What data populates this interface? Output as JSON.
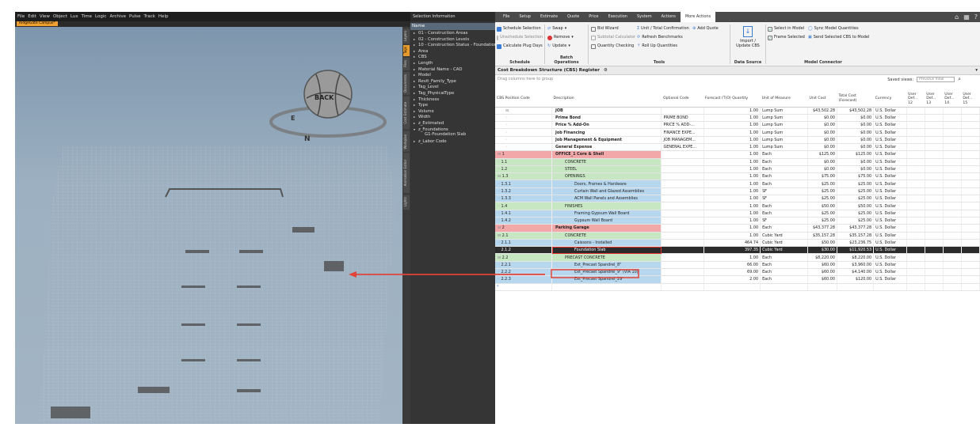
{
  "viewer": {
    "menu": [
      "File",
      "Edit",
      "View",
      "Object",
      "Lux",
      "Time",
      "Logic",
      "Archive",
      "Pulse",
      "Track",
      "Help"
    ],
    "doc_tab": "RidgeGate Campus*",
    "side_tabs": [
      "Layers",
      "Tags",
      "Files",
      "Documents",
      "Cost Estimate",
      "Workplan",
      "Animation Editor",
      "Lights"
    ],
    "active_side_tab": "Tags",
    "gizmo_label": "BACK",
    "compass": [
      "E",
      "N"
    ],
    "panel_title": "Selection Information",
    "name_header": "Name",
    "tree": [
      {
        "label": "01 - Construction Areas",
        "expanded": false
      },
      {
        "label": "02 - Construction Levels",
        "expanded": false
      },
      {
        "label": "10 - Construction Status - Foundation",
        "expanded": false
      },
      {
        "label": "Area",
        "expanded": false
      },
      {
        "label": "CBS",
        "expanded": false
      },
      {
        "label": "Length",
        "expanded": false
      },
      {
        "label": "Material Name - CAD",
        "expanded": false
      },
      {
        "label": "Model",
        "expanded": false
      },
      {
        "label": "Revit_Family_Type",
        "expanded": false
      },
      {
        "label": "Tag_Level",
        "expanded": false
      },
      {
        "label": "Tag_PhysicalType",
        "expanded": false
      },
      {
        "label": "Thickness",
        "expanded": false
      },
      {
        "label": "Type",
        "expanded": false
      },
      {
        "label": "Volume",
        "expanded": false
      },
      {
        "label": "Width",
        "expanded": false
      },
      {
        "label": "z_Estimated",
        "expanded": false
      },
      {
        "label": "z_Foundations",
        "expanded": true
      },
      {
        "label": "G1-Foundation Slab",
        "child": true
      },
      {
        "label": "z_Labor Code",
        "expanded": false
      }
    ]
  },
  "ribbon": {
    "tabs": [
      "File",
      "Setup",
      "Estimate",
      "Quote",
      "Price",
      "Execution",
      "System",
      "Actions",
      "More Actions"
    ],
    "active_tab": "More Actions",
    "schedule": {
      "items": [
        "Schedule Selection",
        "Unschedule Selection",
        "Calculate Plug Days"
      ],
      "label": "Schedule"
    },
    "batch": {
      "items": [
        "Swap",
        "Remove",
        "Update"
      ],
      "label": "Batch Operations"
    },
    "tools": {
      "col1": [
        "Bid Wizard",
        "Subtotal Calculator",
        "Quantity Checking"
      ],
      "col2": [
        "Unit / Total Confirmation",
        "Refresh Benchmarks",
        "Roll Up Quantities"
      ],
      "col3": [
        "Add Quote"
      ],
      "label": "Tools"
    },
    "datasource": {
      "items": [
        "Import /",
        "Update CBS"
      ],
      "label": "Data Source"
    },
    "model": {
      "checks": [
        "Select in Model",
        "Frame Selected"
      ],
      "items": [
        "Sync Model Quantities",
        "Send Selected CBS to Model"
      ],
      "label": "Model Connector"
    }
  },
  "grid": {
    "title": "Cost Breakdown Structure (CBS) Register",
    "drag_hint": "Drag columns here to group",
    "saved_views_label": "Saved views:",
    "saved_views_value": "Previous View",
    "headers": [
      "CBS Position Code",
      "Description",
      "Optional Code",
      "Forecast (T(O) Quantity",
      "Unit of Measure",
      "Unit Cost",
      "Total Cost (Forecast)",
      "Currency",
      "User Def... 12",
      "User Def... 13",
      "User Def... 14",
      "User Def... 15"
    ],
    "rows": [
      {
        "code": "",
        "desc": "JOB",
        "opt": "",
        "qty": "1.00",
        "uom": "Lump Sum",
        "unit": "$43,502.28",
        "total": "$43,502.28",
        "cur": "U.S. Dollar",
        "style": "plain",
        "bold": true
      },
      {
        "code": "",
        "desc": "Prime Bond",
        "opt": "PRIME BOND",
        "qty": "1.00",
        "uom": "Lump Sum",
        "unit": "$0.00",
        "total": "$0.00",
        "cur": "U.S. Dollar",
        "style": "plain",
        "bold": true
      },
      {
        "code": "",
        "desc": "Price % Add-On",
        "opt": "PRICE % ADD-...",
        "qty": "1.00",
        "uom": "Lump Sum",
        "unit": "$0.00",
        "total": "$0.00",
        "cur": "U.S. Dollar",
        "style": "plain",
        "bold": true
      },
      {
        "code": "",
        "desc": "Job Financing",
        "opt": "FINANCE EXPE...",
        "qty": "1.00",
        "uom": "Lump Sum",
        "unit": "$0.00",
        "total": "$0.00",
        "cur": "U.S. Dollar",
        "style": "plain",
        "bold": true
      },
      {
        "code": "",
        "desc": "Job Management & Equipment",
        "opt": "JOB MANAGEM...",
        "qty": "1.00",
        "uom": "Lump Sum",
        "unit": "$0.00",
        "total": "$0.00",
        "cur": "U.S. Dollar",
        "style": "plain",
        "bold": true
      },
      {
        "code": "",
        "desc": "General Expense",
        "opt": "GENERAL EXPE...",
        "qty": "1.00",
        "uom": "Lump Sum",
        "unit": "$0.00",
        "total": "$0.00",
        "cur": "U.S. Dollar",
        "style": "plain",
        "bold": true
      },
      {
        "code": "1",
        "desc": "OFFICE_1 Core & Shell",
        "opt": "",
        "qty": "1.00",
        "uom": "Each",
        "unit": "$125.00",
        "total": "$125.00",
        "cur": "U.S. Dollar",
        "style": "red",
        "bold": true
      },
      {
        "code": "1.1",
        "desc": "CONCRETE",
        "opt": "",
        "qty": "1.00",
        "uom": "Each",
        "unit": "$0.00",
        "total": "$0.00",
        "cur": "U.S. Dollar",
        "style": "green"
      },
      {
        "code": "1.2",
        "desc": "STEEL",
        "opt": "",
        "qty": "1.00",
        "uom": "Each",
        "unit": "$0.00",
        "total": "$0.00",
        "cur": "U.S. Dollar",
        "style": "green"
      },
      {
        "code": "1.3",
        "desc": "OPENINGS",
        "opt": "",
        "qty": "1.00",
        "uom": "Each",
        "unit": "$75.00",
        "total": "$75.00",
        "cur": "U.S. Dollar",
        "style": "green"
      },
      {
        "code": "1.3.1",
        "desc": "Doors, Frames & Hardware",
        "opt": "",
        "qty": "1.00",
        "uom": "Each",
        "unit": "$25.00",
        "total": "$25.00",
        "cur": "U.S. Dollar",
        "style": "blue"
      },
      {
        "code": "1.3.2",
        "desc": "Curtain Wall and Glazed Assemblies",
        "opt": "",
        "qty": "1.00",
        "uom": "SF",
        "unit": "$25.00",
        "total": "$25.00",
        "cur": "U.S. Dollar",
        "style": "blue"
      },
      {
        "code": "1.3.3",
        "desc": "ACM Wall Panels and Assemblies",
        "opt": "",
        "qty": "1.00",
        "uom": "SF",
        "unit": "$25.00",
        "total": "$25.00",
        "cur": "U.S. Dollar",
        "style": "blue"
      },
      {
        "code": "1.4",
        "desc": "FINISHES",
        "opt": "",
        "qty": "1.00",
        "uom": "Each",
        "unit": "$50.00",
        "total": "$50.00",
        "cur": "U.S. Dollar",
        "style": "green"
      },
      {
        "code": "1.4.1",
        "desc": "Framing Gypsum Wall Board",
        "opt": "",
        "qty": "1.00",
        "uom": "Each",
        "unit": "$25.00",
        "total": "$25.00",
        "cur": "U.S. Dollar",
        "style": "blue"
      },
      {
        "code": "1.4.2",
        "desc": "Gypsum Wall Board",
        "opt": "",
        "qty": "1.00",
        "uom": "SF",
        "unit": "$25.00",
        "total": "$25.00",
        "cur": "U.S. Dollar",
        "style": "blue"
      },
      {
        "code": "2",
        "desc": "Parking Garage",
        "opt": "",
        "qty": "1.00",
        "uom": "Each",
        "unit": "$43,377.28",
        "total": "$43,377.28",
        "cur": "U.S. Dollar",
        "style": "red",
        "bold": true
      },
      {
        "code": "2.1",
        "desc": "CONCRETE",
        "opt": "",
        "qty": "1.00",
        "uom": "Cubic Yard",
        "unit": "$35,157.28",
        "total": "$35,157.28",
        "cur": "U.S. Dollar",
        "style": "green"
      },
      {
        "code": "2.1.1",
        "desc": "Caissons - Installed",
        "opt": "",
        "qty": "464.74",
        "uom": "Cubic Yard",
        "unit": "$50.00",
        "total": "$23,236.75",
        "cur": "U.S. Dollar",
        "style": "blue"
      },
      {
        "code": "2.1.2",
        "desc": "Foundation Slab",
        "opt": "",
        "qty": "397.35",
        "uom": "Cubic Yard",
        "unit": "$30.00",
        "total": "$11,920.53",
        "cur": "U.S. Dollar",
        "style": "sel"
      },
      {
        "code": "2.2",
        "desc": "PRECAST CONCRETE",
        "opt": "",
        "qty": "1.00",
        "uom": "Each",
        "unit": "$8,220.00",
        "total": "$8,220.00",
        "cur": "U.S. Dollar",
        "style": "green"
      },
      {
        "code": "2.2.1",
        "desc": "Ext_Precast Spandrel_8\"",
        "opt": "",
        "qty": "66.00",
        "uom": "Each",
        "unit": "$60.00",
        "total": "$3,960.00",
        "cur": "U.S. Dollar",
        "style": "blue"
      },
      {
        "code": "2.2.2",
        "desc": "Ext_Precast Spandrel_9\" (VIA 10)",
        "opt": "",
        "qty": "69.00",
        "uom": "Each",
        "unit": "$60.00",
        "total": "$4,140.00",
        "cur": "U.S. Dollar",
        "style": "blue"
      },
      {
        "code": "2.2.3",
        "desc": "Ext_Precast Spandrel_29\"",
        "opt": "",
        "qty": "2.00",
        "uom": "Each",
        "unit": "$60.00",
        "total": "$120.00",
        "cur": "U.S. Dollar",
        "style": "blue"
      }
    ],
    "new_row_marker": "*"
  },
  "colors": {
    "arrow": "#e0443a",
    "orange": "#e89a2c"
  }
}
